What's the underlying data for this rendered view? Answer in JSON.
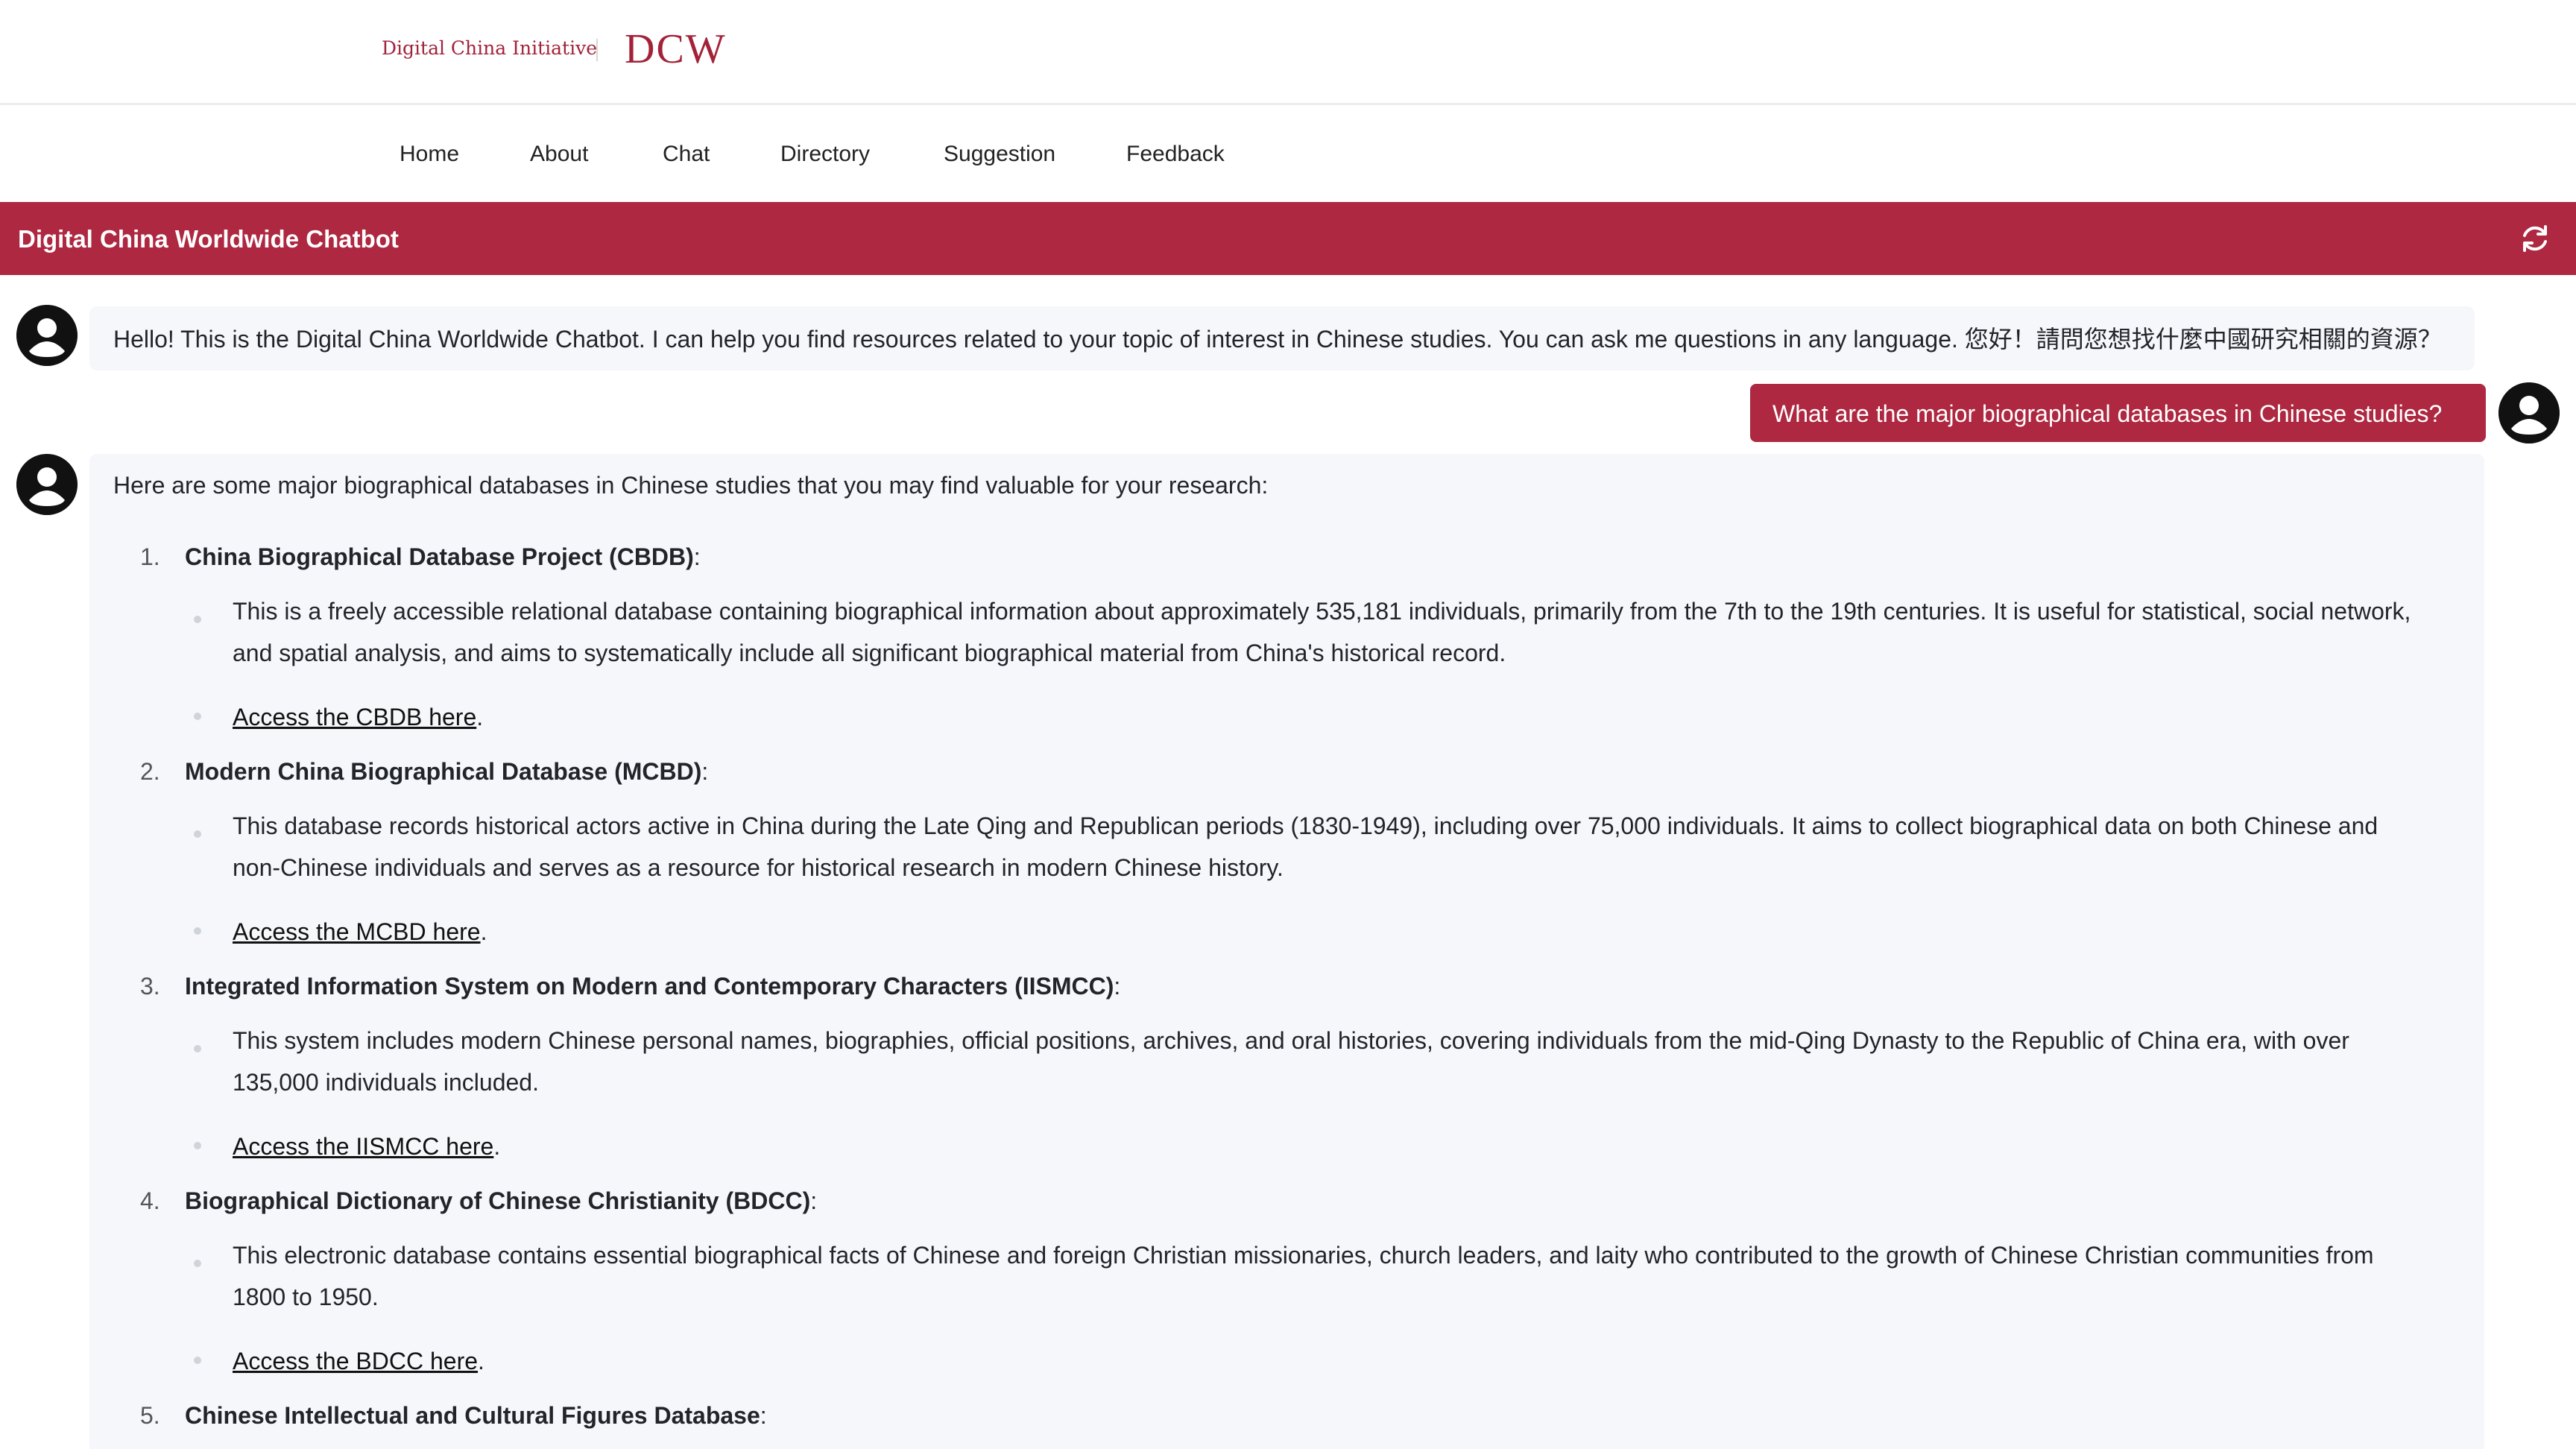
{
  "brand": {
    "initiative": "Digital China Initiative",
    "logo": "DCW"
  },
  "nav": {
    "items": [
      {
        "label": "Home"
      },
      {
        "label": "About"
      },
      {
        "label": "Chat"
      },
      {
        "label": "Directory"
      },
      {
        "label": "Suggestion"
      },
      {
        "label": "Feedback"
      }
    ]
  },
  "chat_header": {
    "title": "Digital China Worldwide Chatbot",
    "refresh_icon": "refresh-icon"
  },
  "messages": {
    "greeting": "Hello! This is the Digital China Worldwide Chatbot. I can help you find resources related to your topic of interest in Chinese studies. You can ask me questions in any language. 您好！請問您想找什麼中國研究相關的資源？",
    "user_question": "What are the major biographical databases in Chinese studies?",
    "response_intro": "Here are some major biographical databases in Chinese studies that you may find valuable for your research:",
    "items": [
      {
        "num": "1.",
        "title": "China Biographical Database Project (CBDB)",
        "desc": "This is a freely accessible relational database containing biographical information about approximately 535,181 individuals, primarily from the 7th to the 19th centuries. It is useful for statistical, social network, and spatial analysis, and aims to systematically include all significant biographical material from China's historical record.",
        "link": "Access the CBDB here"
      },
      {
        "num": "2.",
        "title": "Modern China Biographical Database (MCBD)",
        "desc": "This database records historical actors active in China during the Late Qing and Republican periods (1830-1949), including over 75,000 individuals. It aims to collect biographical data on both Chinese and non-Chinese individuals and serves as a resource for historical research in modern Chinese history.",
        "link": "Access the MCBD here"
      },
      {
        "num": "3.",
        "title": "Integrated Information System on Modern and Contemporary Characters (IISMCC)",
        "desc": "This system includes modern Chinese personal names, biographies, official positions, archives, and oral histories, covering individuals from the mid-Qing Dynasty to the Republic of China era, with over 135,000 individuals included.",
        "link": "Access the IISMCC here"
      },
      {
        "num": "4.",
        "title": "Biographical Dictionary of Chinese Christianity (BDCC)",
        "desc": "This electronic database contains essential biographical facts of Chinese and foreign Christian missionaries, church leaders, and laity who contributed to the growth of Chinese Christian communities from 1800 to 1950.",
        "link": "Access the BDCC here"
      },
      {
        "num": "5.",
        "title": "Chinese Intellectual and Cultural Figures Database"
      }
    ]
  },
  "punct": {
    "colon": ":",
    "period": "."
  },
  "colors": {
    "brand_red": "#ad2840",
    "bubble_bg": "#f6f7fb"
  }
}
